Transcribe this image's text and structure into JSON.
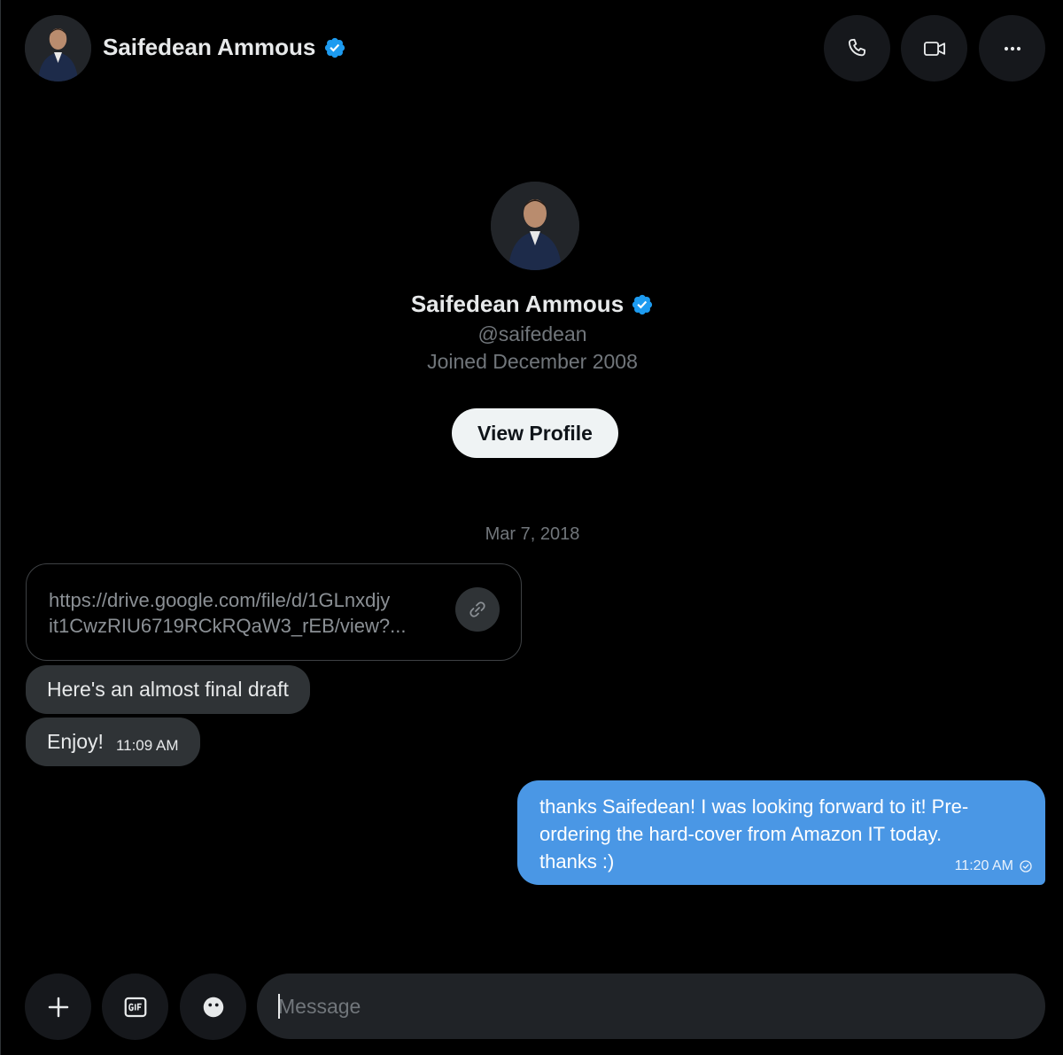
{
  "contact": {
    "name": "Saifedean Ammous",
    "handle": "@saifedean",
    "joined": "Joined December 2008",
    "verified": true
  },
  "header": {
    "actions": [
      "phone-icon",
      "video-icon",
      "more-icon"
    ]
  },
  "profile_card": {
    "view_profile_label": "View Profile"
  },
  "conversation": {
    "date_separator": "Mar 7, 2018",
    "link_preview": {
      "line1": "https://drive.google.com/file/d/1GLnxdjy",
      "line2": "it1CwzRIU6719RCkRQaW3_rEB/view?..."
    },
    "messages": [
      {
        "direction": "in",
        "text": "Here's an almost final draft"
      },
      {
        "direction": "in",
        "text": "Enjoy!",
        "time": "11:09 AM"
      },
      {
        "direction": "out",
        "line1": "thanks Saifedean! I was looking forward to it!  Pre-",
        "line2": "ordering the hard-cover from Amazon IT today.",
        "line3": "thanks :)",
        "time": "11:20 AM"
      }
    ]
  },
  "composer": {
    "placeholder": "Message",
    "buttons": [
      "add-icon",
      "gif-icon",
      "emoji-icon"
    ]
  },
  "colors": {
    "background": "#000000",
    "bubble_in": "#2f3336",
    "bubble_out": "#4a97e5",
    "verified_badge": "#1d9bf0",
    "muted_text": "#71767b"
  }
}
